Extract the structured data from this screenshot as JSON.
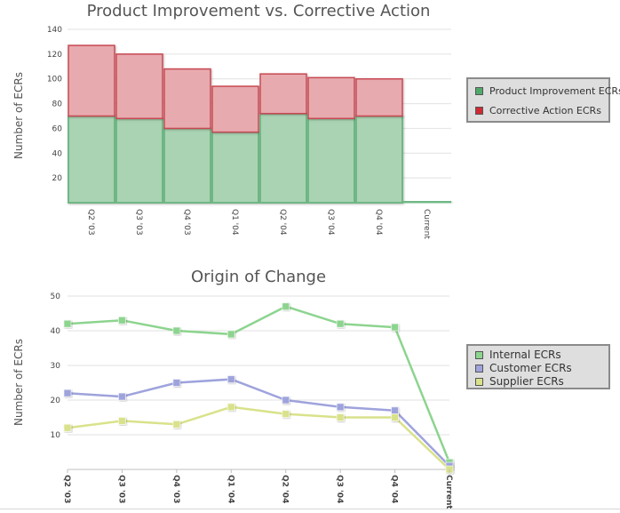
{
  "chart_data": [
    {
      "type": "bar",
      "stacked": true,
      "title": "Product Improvement vs. Corrective Action",
      "ylabel": "Number of ECRs",
      "xlabel": "",
      "ylim": [
        0,
        140
      ],
      "yticks": [
        20,
        40,
        60,
        80,
        100,
        120,
        140
      ],
      "categories": [
        "Q2 '03",
        "Q3 '03",
        "Q4 '03",
        "Q1 '04",
        "Q2 '04",
        "Q3 '04",
        "Q4 '04",
        "Current"
      ],
      "series": [
        {
          "name": "Product Improvement ECRs",
          "color": "#6fb885",
          "fill": "#a9d3b3",
          "values": [
            70,
            68,
            60,
            57,
            72,
            68,
            70,
            1
          ]
        },
        {
          "name": "Corrective Action ECRs",
          "color": "#c84a52",
          "fill": "#e7aaaf",
          "values": [
            57,
            52,
            48,
            37,
            32,
            33,
            30,
            0
          ]
        }
      ],
      "grid": true,
      "legend_position": "right"
    },
    {
      "type": "line",
      "title": "Origin of Change",
      "ylabel": "Number of ECRs",
      "xlabel": "",
      "ylim": [
        0,
        50
      ],
      "yticks": [
        10,
        20,
        30,
        40,
        50
      ],
      "categories": [
        "Q2 '03",
        "Q3 '03",
        "Q4 '03",
        "Q1 '04",
        "Q2 '04",
        "Q3 '04",
        "Q4 '04",
        "Current"
      ],
      "series": [
        {
          "name": "Internal ECRs",
          "color": "#8dd48f",
          "values": [
            42,
            43,
            40,
            39,
            47,
            42,
            41,
            2
          ]
        },
        {
          "name": "Customer ECRs",
          "color": "#9ea3dc",
          "values": [
            22,
            21,
            25,
            26,
            20,
            18,
            17,
            1
          ]
        },
        {
          "name": "Supplier ECRs",
          "color": "#d9e28a",
          "values": [
            12,
            14,
            13,
            18,
            16,
            15,
            15,
            0
          ]
        }
      ],
      "grid": true,
      "legend_position": "right"
    }
  ]
}
